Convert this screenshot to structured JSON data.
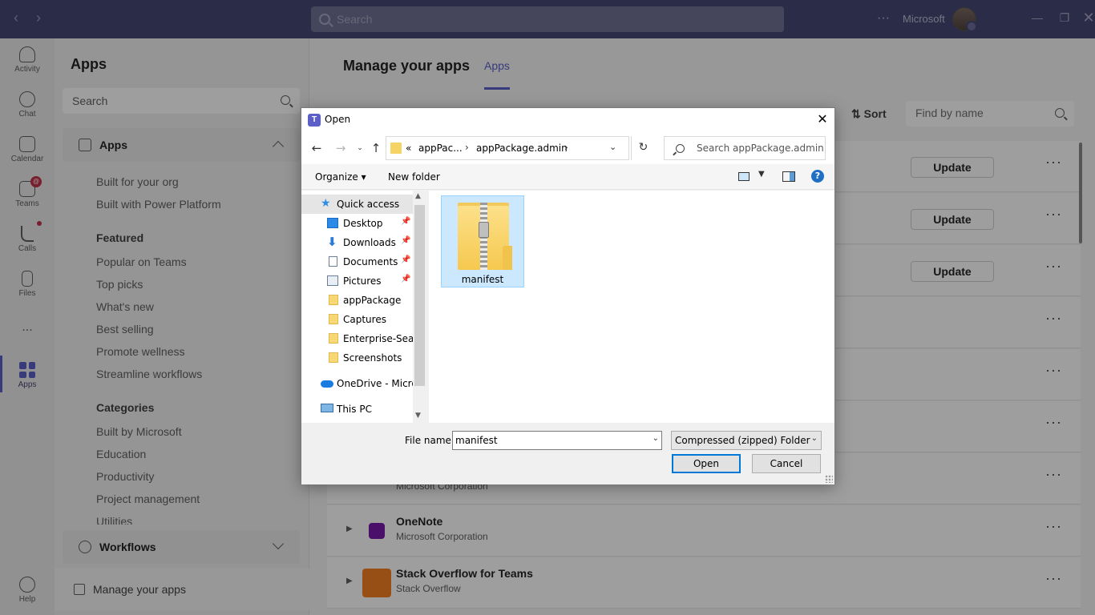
{
  "teams": {
    "search_placeholder": "Search",
    "org_name": "Microsoft",
    "rail": [
      {
        "label": "Activity",
        "icon": "bell-icon"
      },
      {
        "label": "Chat",
        "icon": "chat-icon"
      },
      {
        "label": "Calendar",
        "icon": "calendar-icon"
      },
      {
        "label": "Teams",
        "icon": "teams-icon",
        "badge": "@"
      },
      {
        "label": "Calls",
        "icon": "phone-icon"
      },
      {
        "label": "Files",
        "icon": "file-icon"
      },
      {
        "label": "...",
        "icon": "more-icon"
      },
      {
        "label": "Apps",
        "icon": "apps-icon"
      },
      {
        "label": "Help",
        "icon": "help-icon"
      }
    ],
    "left": {
      "title": "Apps",
      "search_placeholder": "Search",
      "apps_section": "Apps",
      "top_links": [
        "Built for your org",
        "Built with Power Platform"
      ],
      "featured_head": "Featured",
      "featured": [
        "Popular on Teams",
        "Top picks",
        "What's new",
        "Best selling",
        "Promote wellness",
        "Streamline workflows"
      ],
      "categories_head": "Categories",
      "categories": [
        "Built by Microsoft",
        "Education",
        "Productivity",
        "Project management",
        "Utilities"
      ],
      "workflows_section": "Workflows",
      "manage": "Manage your apps"
    },
    "main": {
      "title": "Manage your apps",
      "tab": "Apps",
      "sort": "Sort",
      "find_placeholder": "Find by name",
      "update_label": "Update",
      "rows": [
        {
          "name": "OneNote",
          "publisher": "Microsoft Corporation",
          "color": "#7719aa"
        },
        {
          "name": "Stack Overflow for Teams",
          "publisher": "Stack Overflow",
          "color": "#f48024"
        }
      ],
      "partial_publisher": "Microsoft Corporation"
    }
  },
  "dialog": {
    "title": "Open",
    "breadcrumb": [
      "«",
      "appPac...",
      "appPackage.admin"
    ],
    "search_placeholder": "Search appPackage.admin",
    "organize": "Organize ▾",
    "new_folder": "New folder",
    "help": "?",
    "tree": [
      {
        "label": "Quick access",
        "icon": "star-icon",
        "selected": true,
        "pinned": false
      },
      {
        "label": "Desktop",
        "icon": "desktop-icon",
        "pinned": true
      },
      {
        "label": "Downloads",
        "icon": "download-icon",
        "pinned": true
      },
      {
        "label": "Documents",
        "icon": "documents-icon",
        "pinned": true
      },
      {
        "label": "Pictures",
        "icon": "pictures-icon",
        "pinned": true
      },
      {
        "label": "appPackage",
        "icon": "folder-icon",
        "pinned": false
      },
      {
        "label": "Captures",
        "icon": "folder-icon",
        "pinned": false
      },
      {
        "label": "Enterprise-Searc",
        "icon": "folder-icon",
        "pinned": false
      },
      {
        "label": "Screenshots",
        "icon": "folder-icon",
        "pinned": false
      },
      {
        "label": "OneDrive - Micros",
        "icon": "onedrive-icon",
        "pinned": false
      },
      {
        "label": "This PC",
        "icon": "pc-icon",
        "pinned": false
      }
    ],
    "file": {
      "name": "manifest",
      "icon": "zip-folder-icon"
    },
    "filename_label": "File name:",
    "filename_value": "manifest",
    "filetype": "Compressed (zipped) Folder",
    "open": "Open",
    "cancel": "Cancel"
  }
}
